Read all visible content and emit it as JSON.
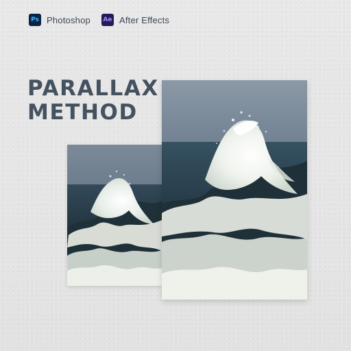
{
  "apps": [
    {
      "label": "Photoshop",
      "badge_text": "Ps",
      "badge_bg": "#0b2245",
      "badge_fg": "#35b7ff",
      "icon": "photoshop-icon"
    },
    {
      "label": "After Effects",
      "badge_text": "Ae",
      "badge_bg": "#221b56",
      "badge_fg": "#9e8cff",
      "icon": "after-effects-icon"
    }
  ],
  "title": {
    "line1": "PARALLAX",
    "line2": "METHOD",
    "color": "#44515f"
  },
  "colors": {
    "background": "#e6e6e6",
    "sky": "#667789",
    "sea": "#243845",
    "foam": "#eef0e5"
  },
  "images": {
    "back": "ocean-wave-photo",
    "front": "ocean-wave-photo"
  }
}
